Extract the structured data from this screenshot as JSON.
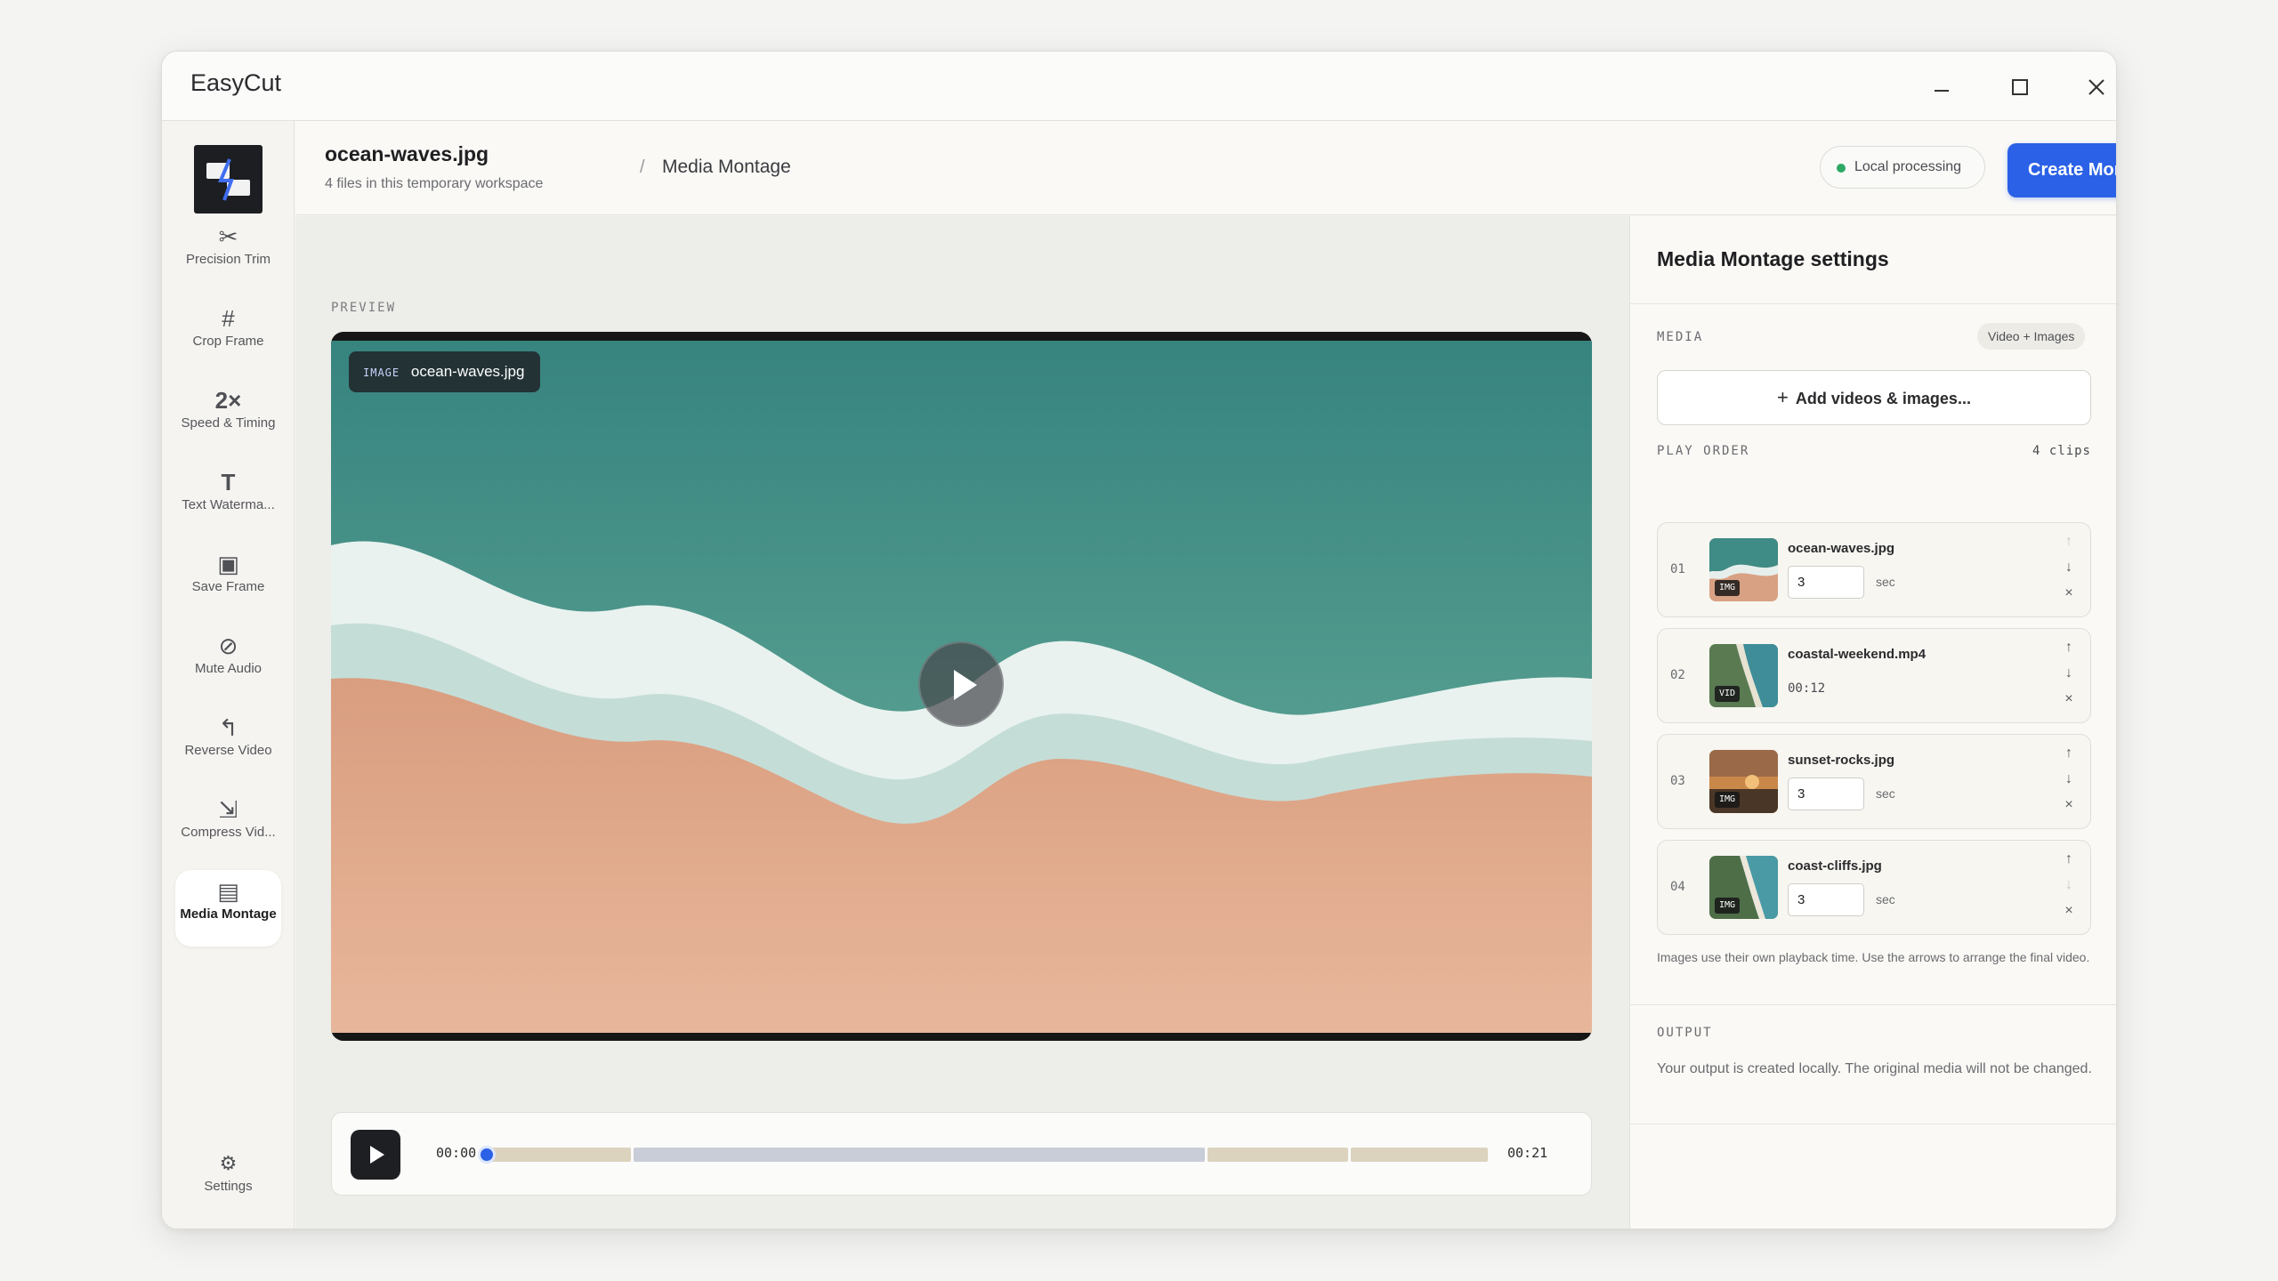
{
  "app": {
    "title": "EasyCut"
  },
  "sidebar": {
    "tools": [
      {
        "label": "Precision Trim",
        "icon": "scissors-icon",
        "glyph": "✂"
      },
      {
        "label": "Crop Frame",
        "icon": "crop-icon",
        "glyph": "#"
      },
      {
        "label": "Speed & Timing",
        "icon": "speed-icon",
        "glyph": "2×"
      },
      {
        "label": "Text Waterma...",
        "icon": "text-icon",
        "glyph": "T"
      },
      {
        "label": "Save Frame",
        "icon": "frame-icon",
        "glyph": "▣"
      },
      {
        "label": "Mute Audio",
        "icon": "mute-icon",
        "glyph": "⊘"
      },
      {
        "label": "Reverse Video",
        "icon": "reverse-icon",
        "glyph": "↰"
      },
      {
        "label": "Compress Vid...",
        "icon": "compress-icon",
        "glyph": "⇲"
      },
      {
        "label": "Media Montage",
        "icon": "montage-icon",
        "glyph": "▤"
      }
    ],
    "settings": {
      "label": "Settings",
      "icon": "gear-icon",
      "glyph": "⚙"
    }
  },
  "header": {
    "file_name": "ocean-waves.jpg",
    "file_sub": "4 files in this temporary workspace",
    "crumb_sep": "/",
    "crumb": "Media Montage",
    "badge": "Local processing",
    "create_label": "Create Montage",
    "create_glyph": "↗"
  },
  "preview": {
    "label": "PREVIEW",
    "tag_kind": "IMAGE",
    "tag_name": "ocean-waves.jpg",
    "time_start": "00:00",
    "time_end": "00:21",
    "progress": 0
  },
  "panel": {
    "title": "Media Montage settings",
    "media_label": "MEDIA",
    "media_pill": "Video + Images",
    "add_plus": "+",
    "add_label": "Add videos & images...",
    "order_label": "PLAY ORDER",
    "clips_count": "4 clips",
    "unit": "sec",
    "ctl_up": "↑",
    "ctl_down": "↓",
    "ctl_remove": "×",
    "clips": [
      {
        "num": "01",
        "name": "ocean-waves.jpg",
        "kind": "IMG",
        "duration": "3"
      },
      {
        "num": "02",
        "name": "coastal-weekend.mp4",
        "kind": "VID",
        "video_duration": "00:12"
      },
      {
        "num": "03",
        "name": "sunset-rocks.jpg",
        "kind": "IMG",
        "duration": "3"
      },
      {
        "num": "04",
        "name": "coast-cliffs.jpg",
        "kind": "IMG",
        "duration": "3"
      }
    ],
    "note": "Images use their own playback time. Use the arrows to arrange the final video.",
    "output_label": "OUTPUT",
    "output_text": "Your output is created locally. The original media will not be changed."
  },
  "colors": {
    "accent": "#2a61e6",
    "status_ok": "#2fa866",
    "segment_image": "#dcd3bf",
    "segment_video": "#c9cdd8"
  }
}
